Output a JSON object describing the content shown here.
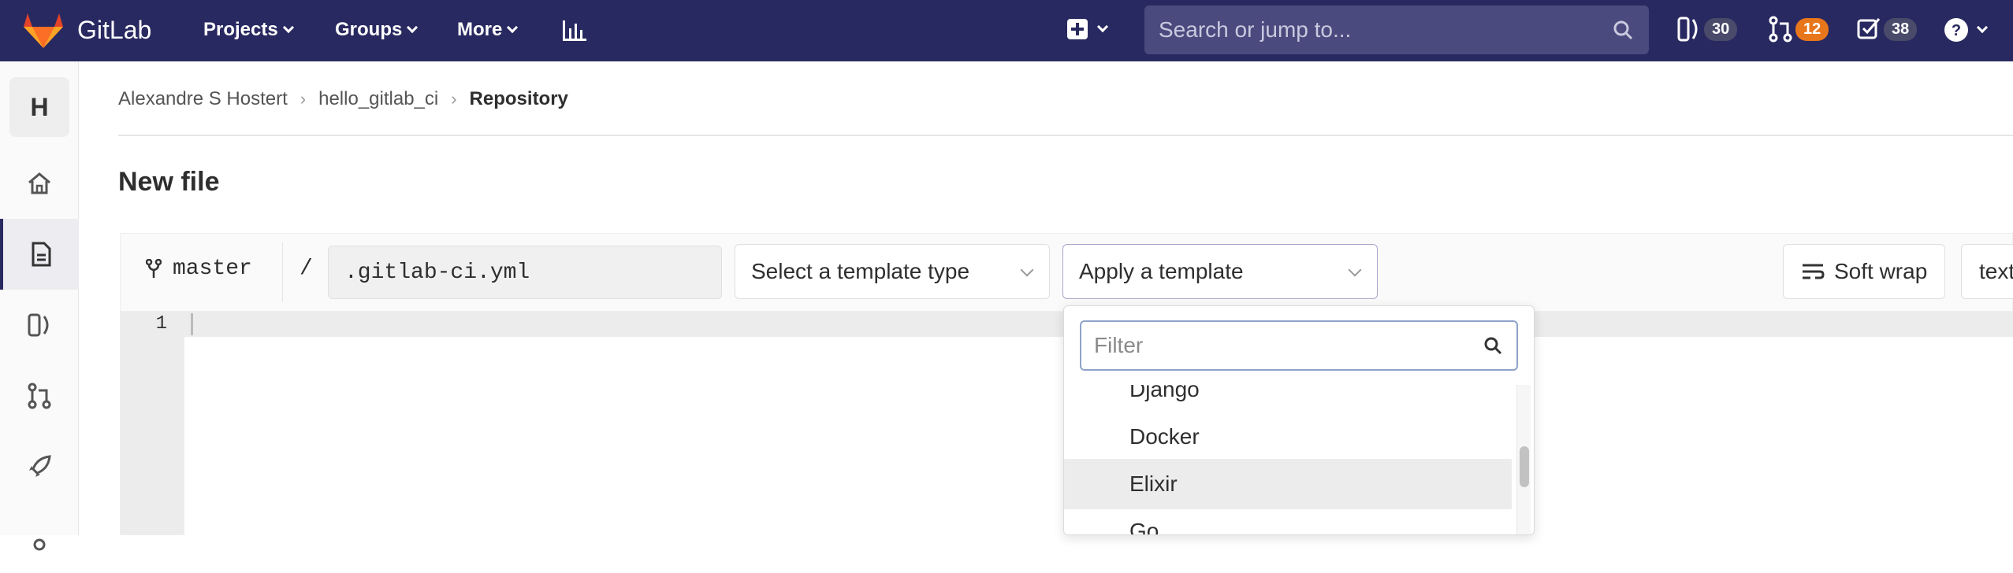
{
  "navbar": {
    "brand": "GitLab",
    "projects_label": "Projects",
    "groups_label": "Groups",
    "more_label": "More",
    "search_placeholder": "Search or jump to...",
    "issues_count": "30",
    "merge_requests_count": "12",
    "todos_count": "38",
    "colors": {
      "bg": "#292961",
      "mr_badge": "#e8761b",
      "badge": "#4a4a6a"
    }
  },
  "sidebar": {
    "avatar_letter": "H",
    "items": [
      "home-icon",
      "repository-icon",
      "issues-icon",
      "merge-requests-icon",
      "ci-cd-icon"
    ]
  },
  "breadcrumb": {
    "owner": "Alexandre S Hostert",
    "project": "hello_gitlab_ci",
    "current": "Repository"
  },
  "page": {
    "title": "New file"
  },
  "file_header": {
    "branch": "master",
    "path_separator": "/",
    "filename": ".gitlab-ci.yml",
    "template_type_label": "Select a template type",
    "apply_template_label": "Apply a template",
    "soft_wrap_label": "Soft wrap",
    "text_button_partial": "text"
  },
  "editor": {
    "line_number": "1"
  },
  "template_dropdown": {
    "filter_placeholder": "Filter",
    "items": [
      "Django",
      "Docker",
      "Elixir",
      "Go"
    ],
    "hovered": "Elixir"
  }
}
